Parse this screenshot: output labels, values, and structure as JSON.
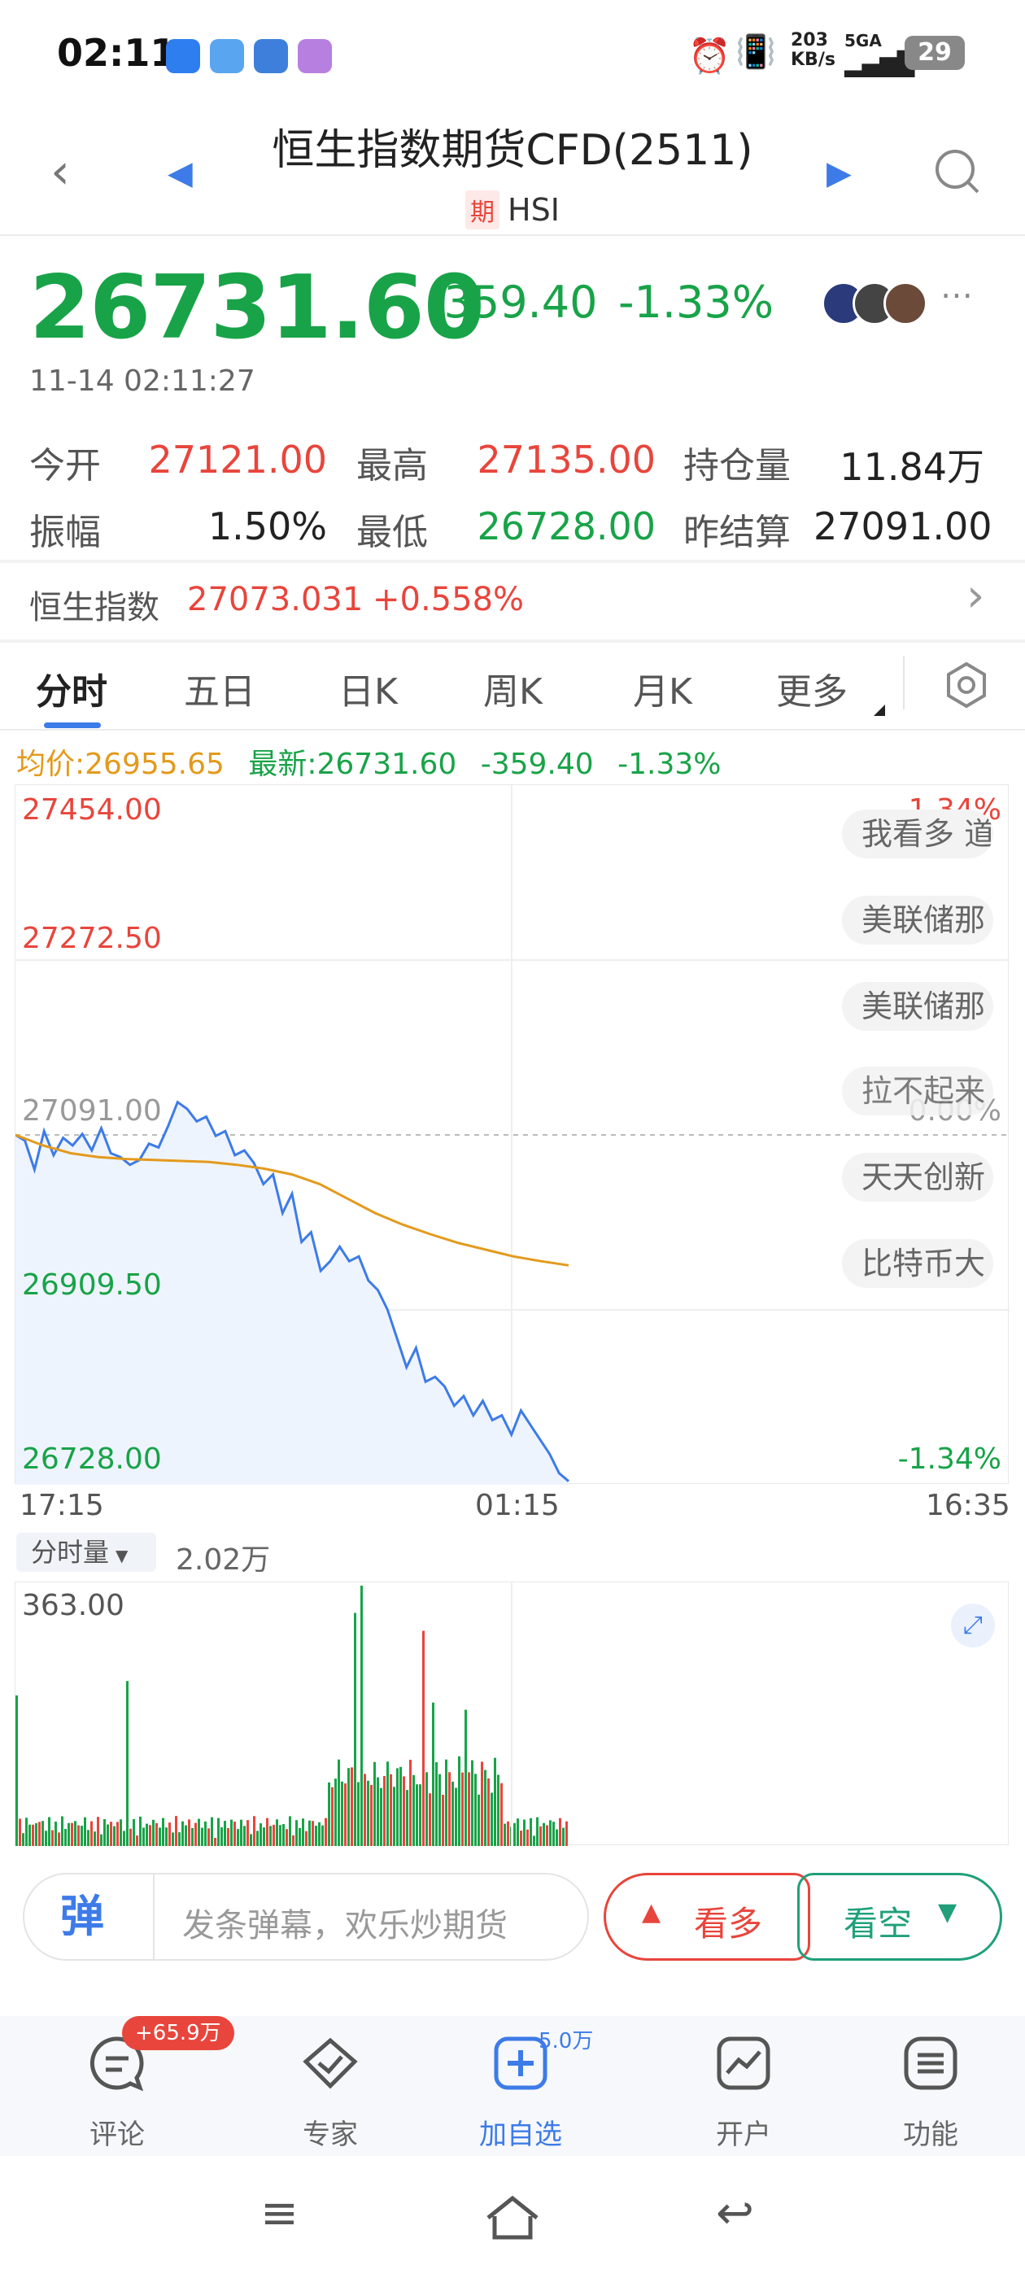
{
  "status_bar": {
    "time": "02:11",
    "net_speed_top": "203",
    "net_speed_bottom": "KB/s",
    "signal": "5GA",
    "battery": "29"
  },
  "header": {
    "title": "恒生指数期货CFD(2511)",
    "badge": "期",
    "symbol": "HSI"
  },
  "quote": {
    "price": "26731.60",
    "change": "-359.40",
    "change_pct": "-1.33%",
    "timestamp": "11-14 02:11:27"
  },
  "stats": [
    {
      "label": "今开",
      "value": "27121.00",
      "color": "red"
    },
    {
      "label": "最高",
      "value": "27135.00",
      "color": "red"
    },
    {
      "label": "持仓量",
      "value": "11.84万",
      "color": "dark"
    },
    {
      "label": "振幅",
      "value": "1.50%",
      "color": "dark"
    },
    {
      "label": "最低",
      "value": "26728.00",
      "color": "green"
    },
    {
      "label": "昨结算",
      "value": "27091.00",
      "color": "dark"
    }
  ],
  "index_bar": {
    "label": "恒生指数",
    "value": "27073.031",
    "pct": "+0.558%"
  },
  "tabs": [
    "分时",
    "五日",
    "日K",
    "周K",
    "月K",
    "更多"
  ],
  "info_row": {
    "avg": "均价:26955.65",
    "latest": "最新:26731.60",
    "chg": "-359.40",
    "pct": "-1.33%"
  },
  "chart": {
    "y_labels": [
      "27454.00",
      "27272.50",
      "27091.00",
      "26909.50",
      "26728.00"
    ],
    "right_labels": [
      "1.34%",
      "0.00%",
      "-1.34%"
    ],
    "x_labels": [
      "17:15",
      "01:15",
      "16:35"
    ],
    "danmaku": [
      "我看多 道",
      "美联储那",
      "美联储那",
      "拉不起来",
      "天天创新",
      "比特币大"
    ]
  },
  "chart_data": {
    "type": "line",
    "series": [
      {
        "values": [
          27091,
          27085,
          27055,
          27095,
          27070,
          27088,
          27080,
          27092,
          27075,
          27098,
          27072,
          27068,
          27060,
          27065,
          27082,
          27078,
          27100,
          27125,
          27118,
          27105,
          27110,
          27090,
          27095,
          27070,
          27075,
          27062,
          27040,
          27050,
          27010,
          27030,
          26980,
          26990,
          26950,
          26960,
          26975,
          26960,
          26965,
          26940,
          26930,
          26910,
          26880,
          26850,
          26870,
          26835,
          26840,
          26830,
          26810,
          26820,
          26800,
          26815,
          26795,
          26800,
          26780,
          26805,
          26790,
          26775,
          26760,
          26740,
          26731.6
        ]
      },
      {
        "values": [
          27091,
          27080,
          27072,
          27068,
          27066,
          27065,
          27064,
          27063,
          27060,
          27056,
          27050,
          27040,
          27025,
          27010,
          26998,
          26988,
          26979,
          26972,
          26965,
          26960,
          26955.65
        ]
      }
    ],
    "ylim": [
      26728.0,
      27454.0
    ],
    "volume_max": 363.0,
    "volume_label": "分时量",
    "volume_value": "2.02万"
  },
  "comment": {
    "icon_text": "弹",
    "placeholder": "发条弹幕，欢乐炒期货"
  },
  "actions": {
    "up": "看多",
    "down": "看空"
  },
  "nav": [
    {
      "label": "评论",
      "badge": "+65.9万"
    },
    {
      "label": "专家",
      "badge": ""
    },
    {
      "label": "加自选",
      "badge": "5.0万"
    },
    {
      "label": "开户",
      "badge": ""
    },
    {
      "label": "功能",
      "badge": ""
    }
  ],
  "colors": {
    "green": "#18a348",
    "red": "#e8453c",
    "blue": "#3d7be8",
    "avg": "#e39a1c"
  }
}
